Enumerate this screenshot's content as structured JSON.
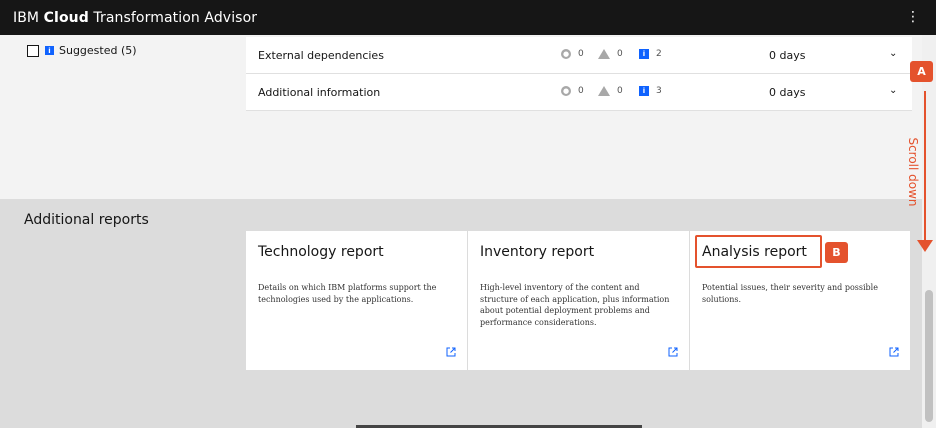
{
  "app": {
    "brand_prefix": "IBM ",
    "brand_bold": "Cloud",
    "brand_suffix": " Transformation Advisor",
    "menu_icon": "overflow-menu-icon"
  },
  "filter": {
    "label": "Suggested (5)",
    "checked": false,
    "icon": "information-icon"
  },
  "rows": [
    {
      "label": "External dependencies",
      "critical_count": "0",
      "warning_count": "0",
      "info_count": "2",
      "days": "0 days"
    },
    {
      "label": "Additional information",
      "critical_count": "0",
      "warning_count": "0",
      "info_count": "3",
      "days": "0 days"
    }
  ],
  "additional_reports": {
    "title": "Additional reports",
    "cards": [
      {
        "title": "Technology report",
        "description": "Details on which IBM platforms support the technologies used by the applications."
      },
      {
        "title": "Inventory report",
        "description": "High-level inventory of the content and structure of each application, plus information about potential deployment problems and performance considerations."
      },
      {
        "title": "Analysis report",
        "description": "Potential issues, their severity and possible solutions."
      }
    ]
  },
  "annotations": {
    "badge_a": "A",
    "badge_b": "B",
    "scroll_hint": "Scroll down",
    "accent_color": "#e4522d"
  },
  "colors": {
    "topbar": "#161616",
    "info_blue": "#0f62fe"
  }
}
